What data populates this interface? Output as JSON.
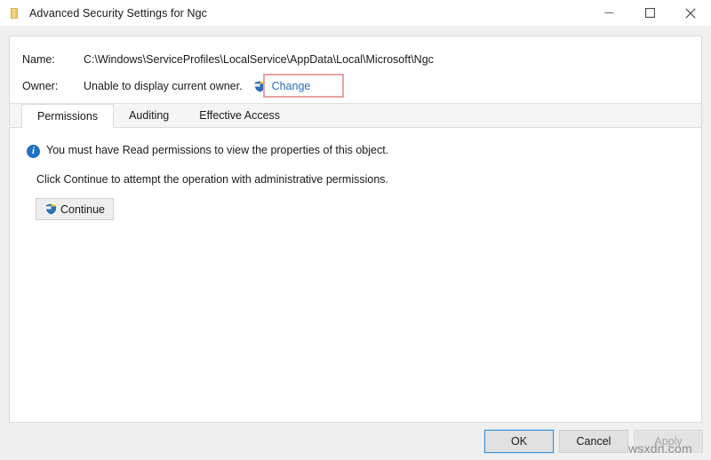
{
  "window": {
    "title": "Advanced Security Settings for Ngc",
    "icon": "folder-icon",
    "controls": {
      "minimize": "minimize-icon",
      "maximize": "maximize-icon",
      "close": "close-icon"
    }
  },
  "header": {
    "name_label": "Name:",
    "name_value": "C:\\Windows\\ServiceProfiles\\LocalService\\AppData\\Local\\Microsoft\\Ngc",
    "owner_label": "Owner:",
    "owner_value": "Unable to display current owner.",
    "change_link": "Change",
    "change_icon": "uac-shield-icon"
  },
  "tabs": [
    {
      "label": "Permissions",
      "active": true
    },
    {
      "label": "Auditing",
      "active": false
    },
    {
      "label": "Effective Access",
      "active": false
    }
  ],
  "content": {
    "info_icon": "info-icon",
    "info_message": "You must have Read permissions to view the properties of this object.",
    "instruction": "Click Continue to attempt the operation with administrative permissions.",
    "continue_button": "Continue",
    "continue_icon": "uac-shield-icon"
  },
  "footer": {
    "ok": "OK",
    "cancel": "Cancel",
    "apply": "Apply"
  },
  "watermark": "wsxdn.com",
  "colors": {
    "accent": "#0078d7",
    "link": "#2a6ab5",
    "info": "#1f72c4",
    "annotation": "#e8a3a3",
    "disabled_text": "#a6a6a6"
  }
}
